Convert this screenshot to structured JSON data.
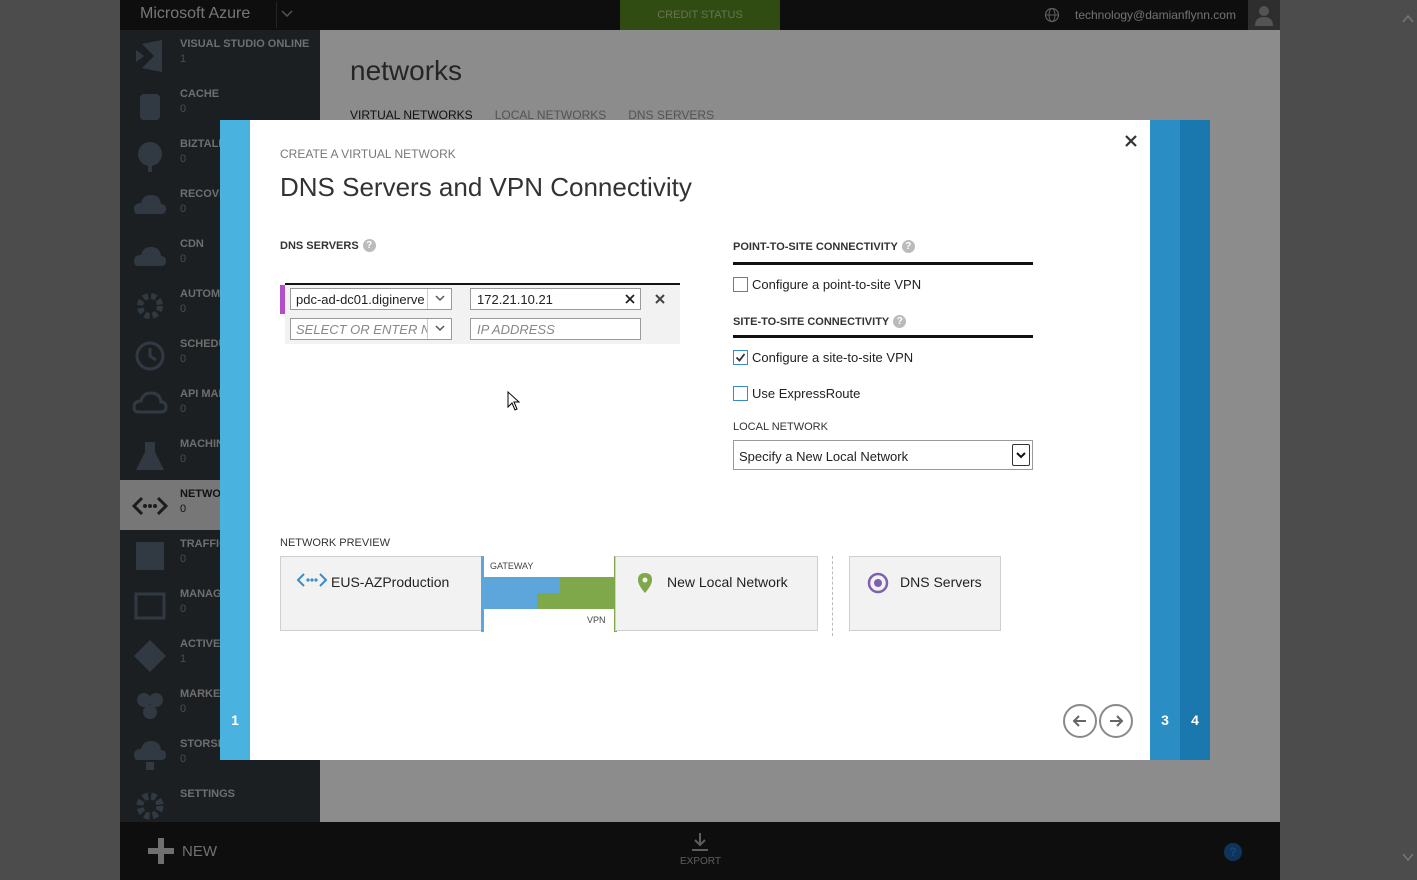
{
  "topbar": {
    "brand": "Microsoft Azure",
    "credit_status": "CREDIT STATUS",
    "user_email": "technology@damianflynn.com"
  },
  "sidebar": {
    "items": [
      {
        "label": "VISUAL STUDIO ONLINE",
        "count": "1",
        "icon": "visual-studio-icon"
      },
      {
        "label": "CACHE",
        "count": "0",
        "icon": "cache-icon"
      },
      {
        "label": "BIZTALK",
        "count": "0",
        "icon": "biztalk-icon"
      },
      {
        "label": "RECOVERY",
        "count": "0",
        "icon": "recovery-icon"
      },
      {
        "label": "CDN",
        "count": "0",
        "icon": "cdn-icon"
      },
      {
        "label": "AUTOMATION",
        "count": "0",
        "icon": "automation-icon"
      },
      {
        "label": "SCHEDULER",
        "count": "0",
        "icon": "scheduler-icon"
      },
      {
        "label": "API MANAGEMENT",
        "count": "0",
        "icon": "api-icon"
      },
      {
        "label": "MACHINE LEARNING",
        "count": "0",
        "icon": "machine-learning-icon"
      },
      {
        "label": "NETWORKS",
        "count": "0",
        "icon": "networks-icon",
        "active": true
      },
      {
        "label": "TRAFFIC MANAGER",
        "count": "0",
        "icon": "traffic-icon"
      },
      {
        "label": "MANAGEMENT SERVICES",
        "count": "0",
        "icon": "management-icon"
      },
      {
        "label": "ACTIVE DIRECTORY",
        "count": "1",
        "icon": "active-directory-icon"
      },
      {
        "label": "MARKETPLACE",
        "count": "0",
        "icon": "marketplace-icon"
      },
      {
        "label": "STORSIMPLE",
        "count": "0",
        "icon": "storsimple-icon"
      },
      {
        "label": "SETTINGS",
        "count": "",
        "icon": "settings-icon"
      }
    ]
  },
  "page": {
    "title": "networks",
    "tabs": [
      "VIRTUAL NETWORKS",
      "LOCAL NETWORKS",
      "DNS SERVERS"
    ]
  },
  "bottombar": {
    "new_label": "NEW",
    "export_label": "EXPORT",
    "help": "?"
  },
  "wizard": {
    "subtitle": "CREATE A VIRTUAL NETWORK",
    "title": "DNS Servers and VPN Connectivity",
    "steps": {
      "current": "1",
      "step3": "3",
      "step4": "4"
    },
    "dns": {
      "label": "DNS SERVERS",
      "rows": [
        {
          "name": "pdc-ad-dc01.diginerve",
          "ip": "172.21.10.21"
        }
      ],
      "name_placeholder": "SELECT OR ENTER NAME",
      "ip_placeholder": "IP ADDRESS"
    },
    "p2s": {
      "label": "POINT-TO-SITE CONNECTIVITY",
      "checkbox_label": "Configure a point-to-site VPN",
      "checked": false
    },
    "s2s": {
      "label": "SITE-TO-SITE CONNECTIVITY",
      "checkbox_label": "Configure a site-to-site VPN",
      "checked": true,
      "expressroute_label": "Use ExpressRoute",
      "expressroute_checked": false
    },
    "local_network": {
      "label": "LOCAL NETWORK",
      "value": "Specify a New Local Network"
    },
    "preview": {
      "label": "NETWORK PREVIEW",
      "vnet_name": "EUS-AZProduction",
      "gateway_label": "GATEWAY",
      "vpn_label": "VPN",
      "local_name": "New Local Network",
      "dns_name": "DNS Servers"
    },
    "colors": {
      "wizard_accent": "#49b2df",
      "dns_row_marker": "#b44ec7",
      "gateway_blue": "#5ca6db",
      "vpn_green": "#7fa84a",
      "dns_icon": "#7e5fb0"
    }
  }
}
